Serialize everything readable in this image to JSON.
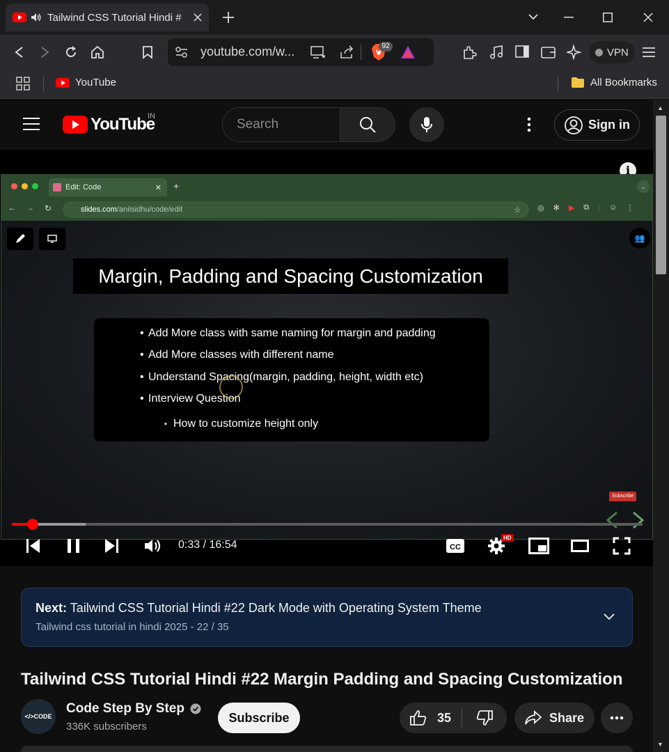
{
  "browser": {
    "tab_title": "Tailwind CSS Tutorial Hindi #",
    "url": "youtube.com/w...",
    "badge_count": "92",
    "vpn_label": "VPN",
    "bookmarks": {
      "youtube": "YouTube",
      "all_bookmarks": "All Bookmarks"
    }
  },
  "youtube": {
    "logo_text": "YouTube",
    "region": "IN",
    "search_placeholder": "Search",
    "sign_in": "Sign in"
  },
  "video": {
    "inner_tab": "Edit: Code",
    "inner_url_host": "slides.com",
    "inner_url_path": "/anilsidhu/code/edit",
    "slide_title": "Margin, Padding and Spacing Customization",
    "bullets": [
      "Add More class with same naming for margin and padding",
      "Add More classes with different name",
      "Understand Spacing(margin, padding, height, width etc)",
      "Interview Question"
    ],
    "sub_bullet": "How to customize height only",
    "subscribe_watermark": "Subscribe",
    "progress_fraction": 0.033,
    "buffered_fraction": 0.117,
    "time_display": "0:33 / 16:54",
    "hd_badge": "HD"
  },
  "next": {
    "prefix": "Next:",
    "title": "Tailwind CSS Tutorial Hindi #22 Dark Mode with Operating System Theme",
    "playlist": "Tailwind css tutorial in hindi 2025 - 22 / 35"
  },
  "details": {
    "title": "Tailwind CSS Tutorial Hindi #22 Margin Padding and Spacing Customization",
    "channel": "Code Step By Step",
    "avatar_text": "</>CODE",
    "subscribers": "336K subscribers",
    "subscribe": "Subscribe",
    "likes": "35",
    "share": "Share"
  },
  "colors": {
    "accent": "#ff0000",
    "background": "#0f0f0f",
    "next_card": "#10223d"
  }
}
